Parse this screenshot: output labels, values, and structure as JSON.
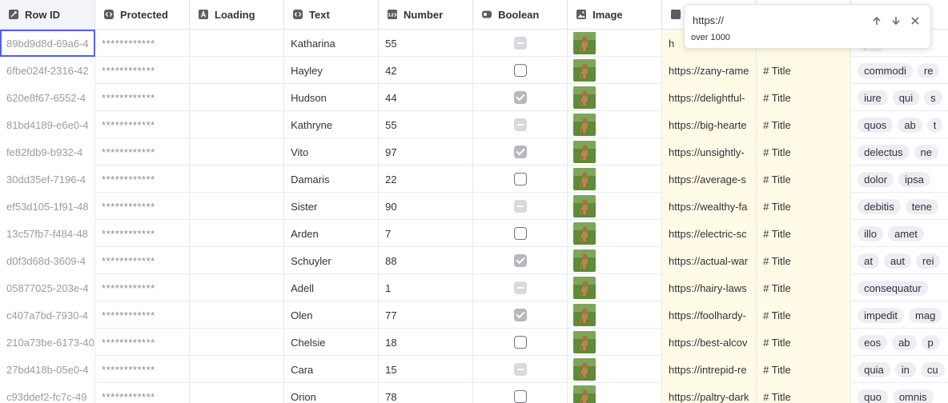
{
  "columns": [
    {
      "label": "Row ID",
      "icon": "row-id-icon"
    },
    {
      "label": "Protected",
      "icon": "code-icon"
    },
    {
      "label": "Loading",
      "icon": "text-a-icon"
    },
    {
      "label": "Text",
      "icon": "code-icon"
    },
    {
      "label": "Number",
      "icon": "number-123-icon"
    },
    {
      "label": "Boolean",
      "icon": "toggle-icon"
    },
    {
      "label": "Image",
      "icon": "image-icon"
    },
    {
      "label": "",
      "icon": "link-icon"
    },
    {
      "label": "",
      "icon": "markdown-icon"
    },
    {
      "label": "",
      "icon": "tags-icon"
    }
  ],
  "rows": [
    {
      "id": "89bd9d8d-69a6-4",
      "protected": "************",
      "text": "Katharina",
      "number": "55",
      "bool": "indeterminate",
      "uri": "h",
      "md": "",
      "tags": [
        "pro"
      ]
    },
    {
      "id": "6fbe024f-2316-42",
      "protected": "************",
      "text": "Hayley",
      "number": "42",
      "bool": "unchecked",
      "uri": "https://zany-rame",
      "md": "# Title",
      "tags": [
        "commodi",
        "re"
      ]
    },
    {
      "id": "620e8f67-6552-4",
      "protected": "************",
      "text": "Hudson",
      "number": "44",
      "bool": "checked",
      "uri": "https://delightful-",
      "md": "# Title",
      "tags": [
        "iure",
        "qui",
        "s"
      ]
    },
    {
      "id": "81bd4189-e6e0-4",
      "protected": "************",
      "text": "Kathryne",
      "number": "55",
      "bool": "indeterminate",
      "uri": "https://big-hearte",
      "md": "# Title",
      "tags": [
        "quos",
        "ab",
        "t"
      ]
    },
    {
      "id": "fe82fdb9-b932-4",
      "protected": "************",
      "text": "Vito",
      "number": "97",
      "bool": "checked",
      "uri": "https://unsightly-",
      "md": "# Title",
      "tags": [
        "delectus",
        "ne"
      ]
    },
    {
      "id": "30dd35ef-7196-4",
      "protected": "************",
      "text": "Damaris",
      "number": "22",
      "bool": "unchecked",
      "uri": "https://average-s",
      "md": "# Title",
      "tags": [
        "dolor",
        "ipsa"
      ]
    },
    {
      "id": "ef53d105-1f91-48",
      "protected": "************",
      "text": "Sister",
      "number": "90",
      "bool": "indeterminate",
      "uri": "https://wealthy-fa",
      "md": "# Title",
      "tags": [
        "debitis",
        "tene"
      ]
    },
    {
      "id": "13c57fb7-f484-48",
      "protected": "************",
      "text": "Arden",
      "number": "7",
      "bool": "unchecked",
      "uri": "https://electric-sc",
      "md": "# Title",
      "tags": [
        "illo",
        "amet"
      ]
    },
    {
      "id": "d0f3d68d-3609-4",
      "protected": "************",
      "text": "Schuyler",
      "number": "88",
      "bool": "checked",
      "uri": "https://actual-war",
      "md": "# Title",
      "tags": [
        "at",
        "aut",
        "rei"
      ]
    },
    {
      "id": "05877025-203e-4",
      "protected": "************",
      "text": "Adell",
      "number": "1",
      "bool": "indeterminate",
      "uri": "https://hairy-laws",
      "md": "# Title",
      "tags": [
        "consequatur"
      ]
    },
    {
      "id": "c407a7bd-7930-4",
      "protected": "************",
      "text": "Olen",
      "number": "77",
      "bool": "checked",
      "uri": "https://foolhardy-",
      "md": "# Title",
      "tags": [
        "impedit",
        "mag"
      ]
    },
    {
      "id": "210a73be-6173-40",
      "protected": "************",
      "text": "Chelsie",
      "number": "18",
      "bool": "unchecked",
      "uri": "https://best-alcov",
      "md": "# Title",
      "tags": [
        "eos",
        "ab",
        "p"
      ]
    },
    {
      "id": "27bd418b-05e0-4",
      "protected": "************",
      "text": "Cara",
      "number": "15",
      "bool": "indeterminate",
      "uri": "https://intrepid-re",
      "md": "# Title",
      "tags": [
        "quia",
        "in",
        "cu"
      ]
    },
    {
      "id": "c93ddef2-fc7c-49",
      "protected": "************",
      "text": "Orion",
      "number": "78",
      "bool": "unchecked",
      "uri": "https://paltry-dark",
      "md": "# Title",
      "tags": [
        "quo",
        "omnis"
      ]
    }
  ],
  "search": {
    "query": "https://",
    "hint": "over 1000",
    "prev_icon": "arrow-up-icon",
    "next_icon": "arrow-down-icon",
    "close_icon": "close-icon"
  },
  "colors": {
    "accent": "#4f5dff",
    "uri_bg": "#fffbe6",
    "header_first_bg": "#f3f4f7"
  }
}
